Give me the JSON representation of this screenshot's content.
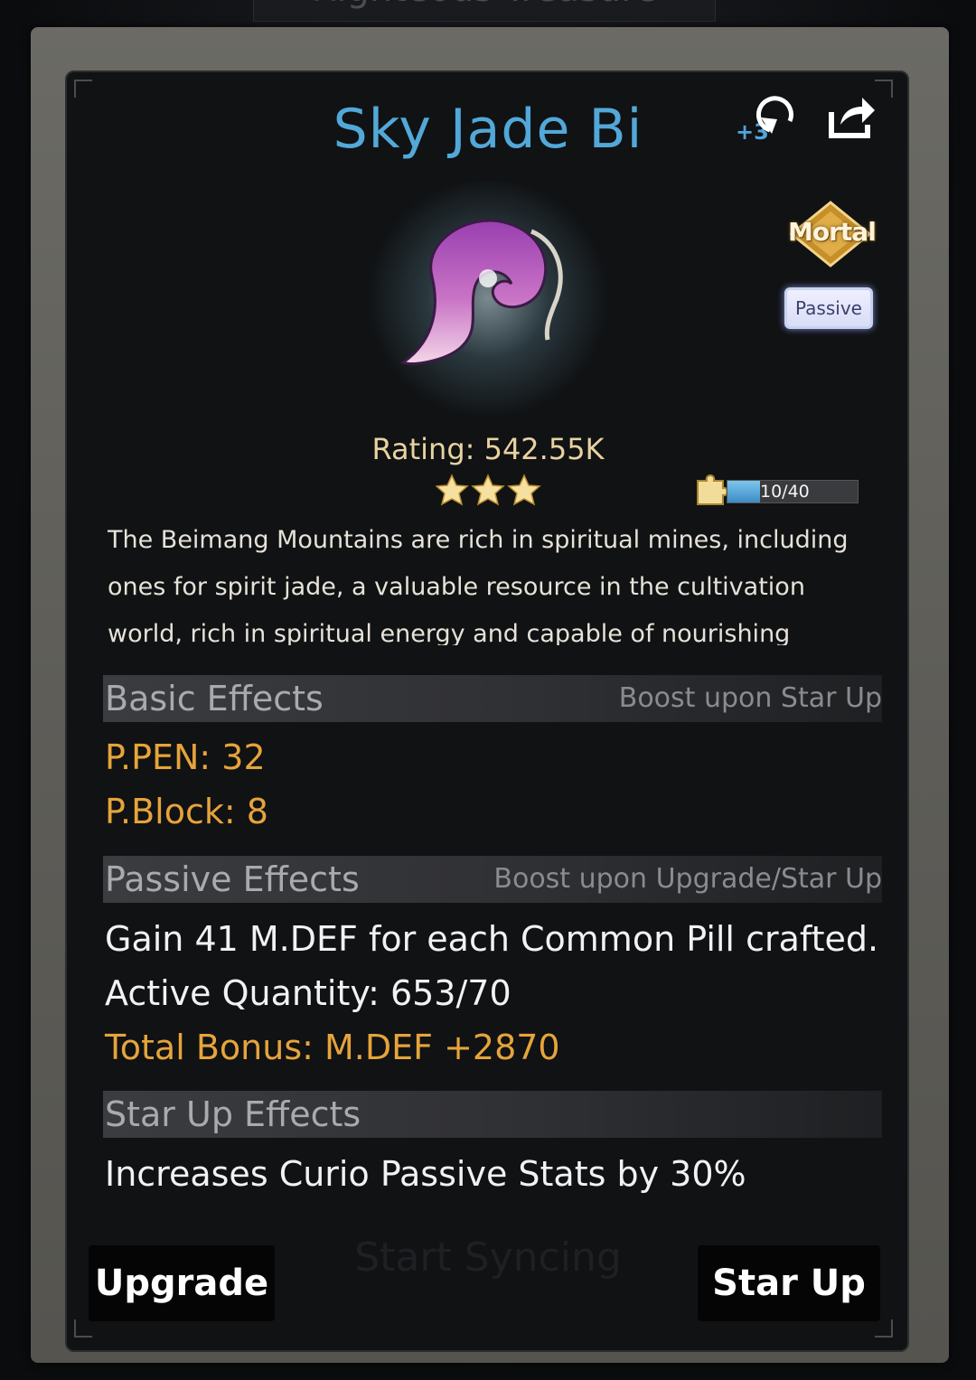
{
  "background": {
    "title": "Righteous Treasure",
    "ghost_button": "Start Syncing"
  },
  "item": {
    "name": "Sky Jade Bi",
    "rank": "Mortal",
    "type_tag": "Passive",
    "rating": "Rating: 542.55K",
    "stars": 3,
    "fragments": {
      "text": "10/40",
      "progress": 0.25
    },
    "description": "The Beimang Mountains are rich in spiritual mines, including ones for spirit jade, a valuable resource in the cultivation world, rich in spiritual energy and capable of nourishing"
  },
  "header_icons": {
    "cycle": "cycle-icon",
    "cycle_label": "+3",
    "share": "share-icon"
  },
  "basic_effects": {
    "title": "Basic Effects",
    "note": "Boost upon Star Up",
    "stats": [
      "P.PEN: 32",
      "P.Block: 8"
    ]
  },
  "passive_effects": {
    "title": "Passive Effects",
    "note": "Boost upon Upgrade/Star Up",
    "effect": "Gain 41 M.DEF for each Common Pill crafted.",
    "active_quantity": "Active Quantity: 653/70",
    "total_bonus": "Total Bonus: M.DEF +2870"
  },
  "star_up_effects": {
    "title": "Star Up Effects",
    "effect": "Increases Curio Passive Stats by 30%"
  },
  "buttons": {
    "upgrade": "Upgrade",
    "star_up": "Star Up"
  },
  "colors": {
    "title": "#52a8d8",
    "gold": "#e6a43a",
    "frame": "#5e5d58"
  }
}
